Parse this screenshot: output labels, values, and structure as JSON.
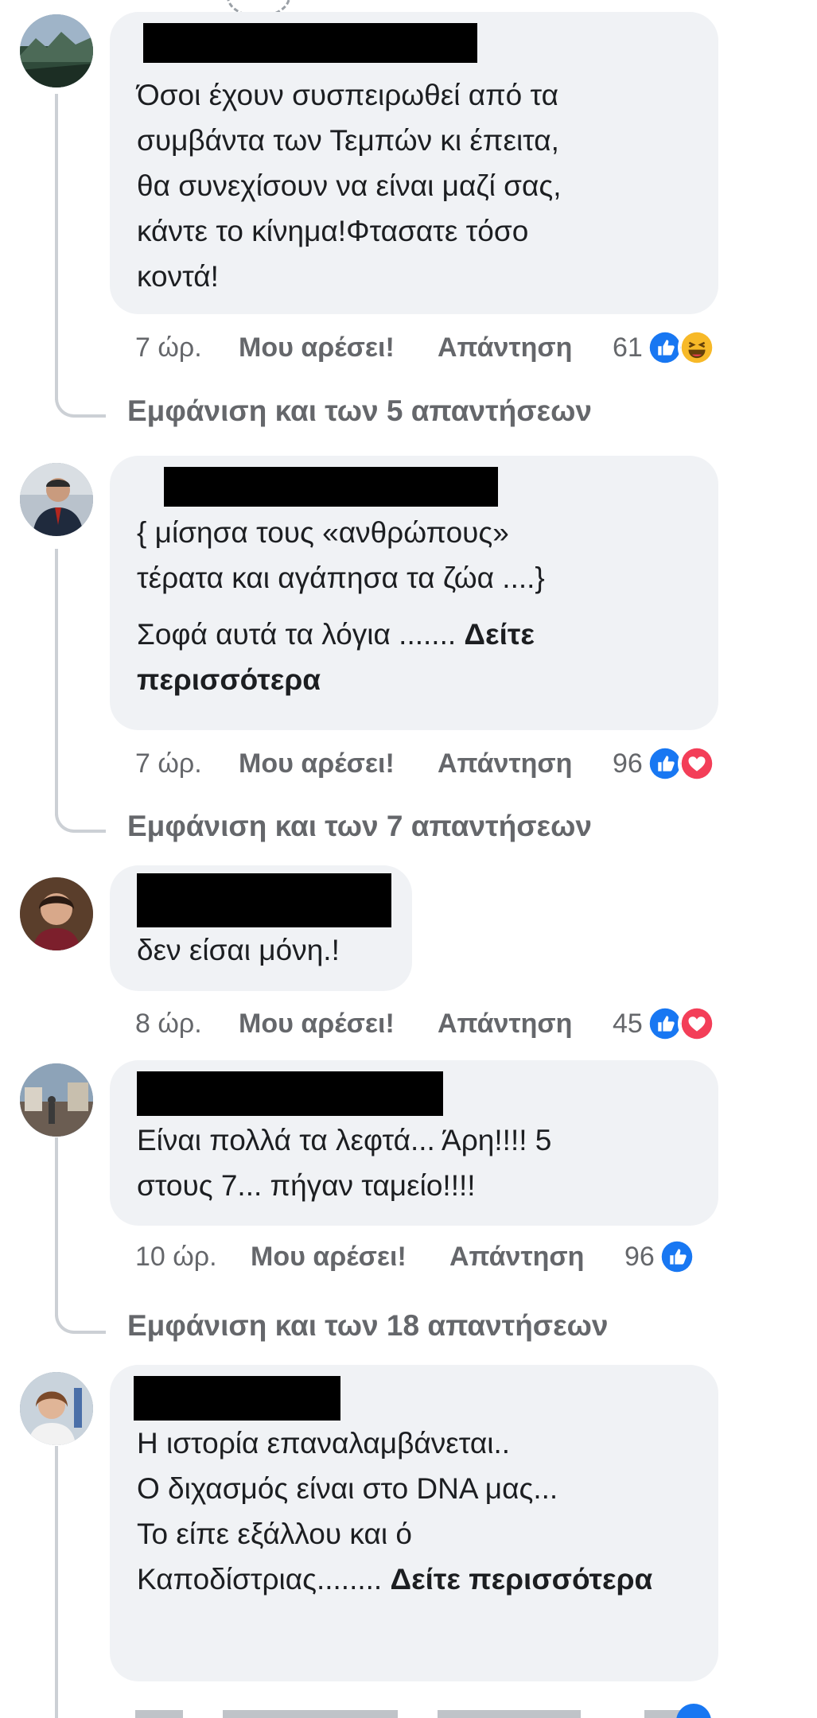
{
  "actions": {
    "like_label": "Μου αρέσει!",
    "reply_label": "Απάντηση",
    "see_more_label": "Δείτε περισσότερα"
  },
  "comments": [
    {
      "text": "Όσοι έχουν συσπειρωθεί από τα\nσυμβάντα των Τεμπών κι έπειτα,\nθα συνεχίσουν να είναι μαζί σας,\nκάντε το κίνημα!Φτασατε τόσο\nκοντά!",
      "time": "7 ώρ.",
      "reaction_count": "61",
      "reactions": [
        "like-reaction-icon",
        "haha-reaction-icon"
      ],
      "view_replies": "Εμφάνιση και των 5 απαντήσεων"
    },
    {
      "text": "{ μίσησα τους «ανθρώπους»\nτέρατα και αγάπησα τα ζώα ....}",
      "text2": "Σοφά αυτά τα λόγια ....... ",
      "time": "7 ώρ.",
      "reaction_count": "96",
      "reactions": [
        "like-reaction-icon",
        "love-reaction-icon"
      ],
      "view_replies": "Εμφάνιση και των 7 απαντήσεων"
    },
    {
      "text": "δεν είσαι μόνη.!",
      "time": "8 ώρ.",
      "reaction_count": "45",
      "reactions": [
        "like-reaction-icon",
        "love-reaction-icon"
      ]
    },
    {
      "text": "Είναι πολλά τα λεφτά... Άρη!!!! 5\nστους 7... πήγαν ταμείο!!!!",
      "time": "10 ώρ.",
      "reaction_count": "96",
      "reactions": [
        "like-reaction-icon"
      ],
      "view_replies": "Εμφάνιση και των 18 απαντήσεων"
    },
    {
      "text": "Η ιστορία επαναλαμβάνεται..\nΟ διχασμός είναι στο DNA μας...\nΤο είπε εξάλλου και ό\nΚαποδίστριας........ ",
      "time": "",
      "reaction_count": ""
    }
  ],
  "colors": {
    "bubble": "#f0f2f5",
    "like_blue": "#1877f2",
    "love_red": "#f33e58",
    "haha_yellow": "#f7b928",
    "meta_gray": "#65676b"
  }
}
